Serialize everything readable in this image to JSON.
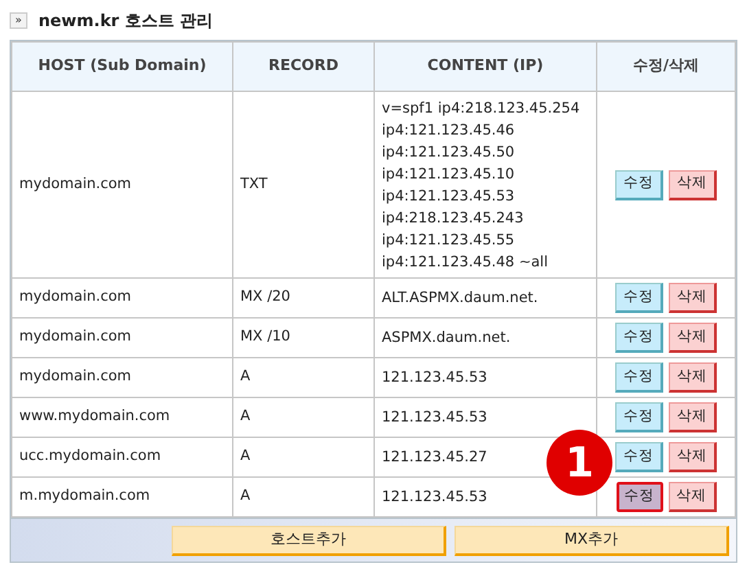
{
  "title": {
    "marker": "»",
    "text": "newm.kr 호스트 관리"
  },
  "table": {
    "columns": [
      "HOST (Sub Domain)",
      "RECORD",
      "CONTENT (IP)",
      "수정/삭제"
    ],
    "rows": [
      {
        "host": "mydomain.com",
        "record": "TXT",
        "content": [
          "v=spf1 ip4:218.123.45.254",
          "ip4:121.123.45.46",
          "ip4:121.123.45.50",
          "ip4:121.123.45.10",
          "ip4:121.123.45.53",
          "ip4:218.123.45.243",
          "ip4:121.123.45.55",
          "ip4:121.123.45.48 ~all"
        ],
        "edit": "수정",
        "delete": "삭제",
        "highlighted": false
      },
      {
        "host": "mydomain.com",
        "record": "MX /20",
        "content": [
          "ALT.ASPMX.daum.net."
        ],
        "edit": "수정",
        "delete": "삭제",
        "highlighted": false
      },
      {
        "host": "mydomain.com",
        "record": "MX /10",
        "content": [
          "ASPMX.daum.net."
        ],
        "edit": "수정",
        "delete": "삭제",
        "highlighted": false
      },
      {
        "host": "mydomain.com",
        "record": "A",
        "content": [
          "121.123.45.53"
        ],
        "edit": "수정",
        "delete": "삭제",
        "highlighted": false
      },
      {
        "host": "www.mydomain.com",
        "record": "A",
        "content": [
          "121.123.45.53"
        ],
        "edit": "수정",
        "delete": "삭제",
        "highlighted": false
      },
      {
        "host": "ucc.mydomain.com",
        "record": "A",
        "content": [
          "121.123.45.27"
        ],
        "edit": "수정",
        "delete": "삭제",
        "highlighted": false
      },
      {
        "host": "m.mydomain.com",
        "record": "A",
        "content": [
          "121.123.45.53"
        ],
        "edit": "수정",
        "delete": "삭제",
        "highlighted": true
      }
    ]
  },
  "footer_buttons": [
    "호스트추가",
    "MX추가"
  ],
  "callout": {
    "text": "1"
  }
}
